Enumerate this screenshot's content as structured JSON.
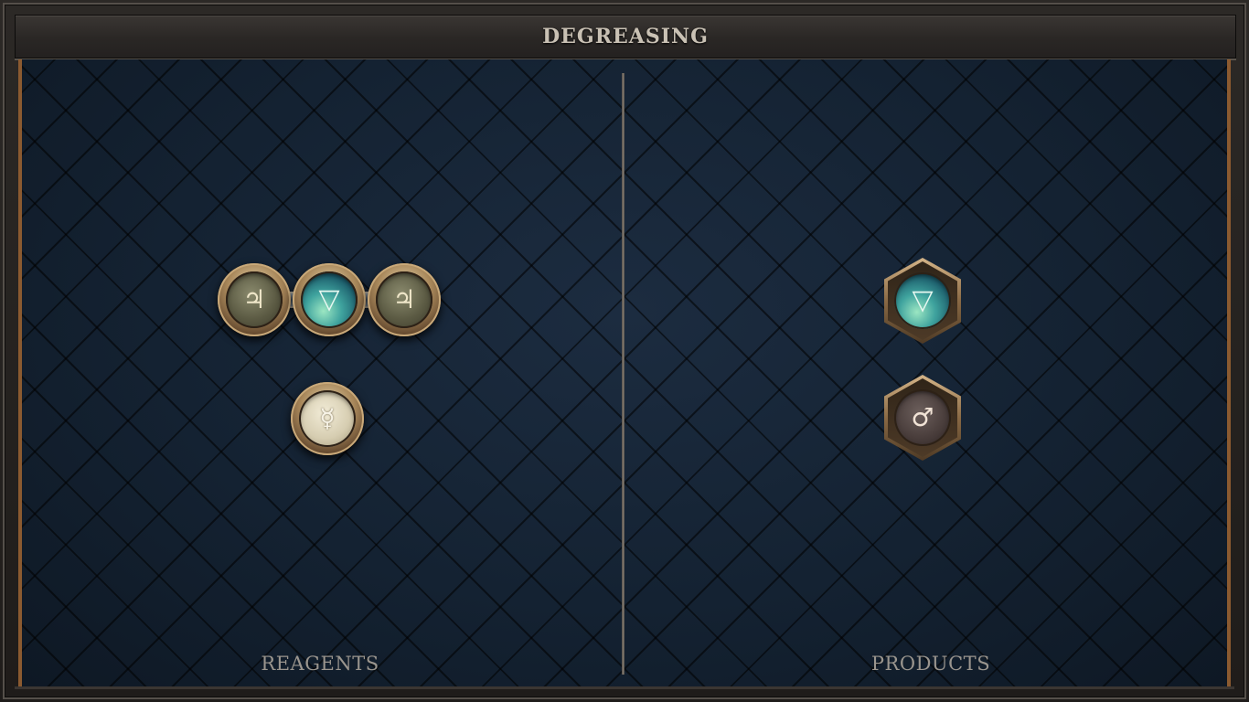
{
  "title": "DEGREASING",
  "reagents": {
    "label": "REAGENTS",
    "molecule": [
      {
        "name": "salt",
        "symbol": "♃"
      },
      {
        "name": "water",
        "symbol": "▽"
      },
      {
        "name": "salt",
        "symbol": "♃"
      }
    ],
    "single": {
      "name": "quicksilver",
      "symbol": "☿"
    }
  },
  "products": {
    "label": "PRODUCTS",
    "items": [
      {
        "name": "water",
        "symbol": "▽"
      },
      {
        "name": "iron",
        "symbol": "♂"
      }
    ]
  },
  "colors": {
    "panel_background": "#142030",
    "frame_accent": "#8b5a30",
    "label_text": "#9a958e",
    "title_text": "#c9c1b4"
  }
}
